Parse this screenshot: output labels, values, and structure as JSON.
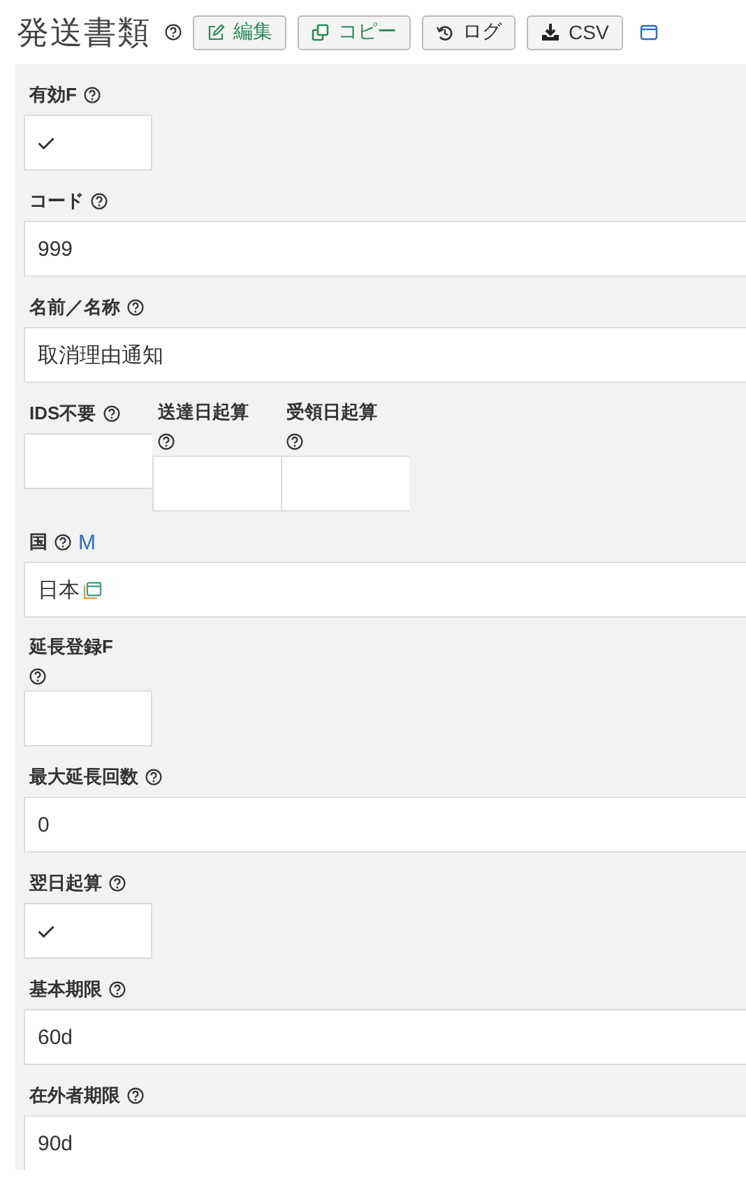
{
  "header": {
    "title": "発送書類",
    "buttons": [
      {
        "kind": "edit",
        "label": "編集"
      },
      {
        "kind": "copy",
        "label": "コピー"
      },
      {
        "kind": "log",
        "label": "ログ"
      },
      {
        "kind": "download",
        "label": "CSV"
      }
    ]
  },
  "fields": [
    {
      "kind": "check",
      "label": "有効F",
      "checked": true
    },
    {
      "kind": "text",
      "label": "コード",
      "value": "999"
    },
    {
      "kind": "text",
      "label": "名前／名称",
      "value": "取消理由通知"
    },
    {
      "kind": "group",
      "fields": [
        {
          "kind": "check",
          "label": "IDS不要",
          "checked": false
        },
        {
          "kind": "check",
          "label": "送達日起算",
          "checked": false
        },
        {
          "kind": "check",
          "label": "受領日起算",
          "checked": false
        }
      ]
    },
    {
      "kind": "link",
      "label": "国",
      "badge": "M",
      "value": "日本"
    },
    {
      "kind": "check",
      "label": "延長登録F",
      "checked": false
    },
    {
      "kind": "text",
      "label": "最大延長回数",
      "value": "0"
    },
    {
      "kind": "check",
      "label": "翌日起算",
      "checked": true
    },
    {
      "kind": "text",
      "label": "基本期限",
      "value": "60d"
    },
    {
      "kind": "text",
      "label": "在外者期限",
      "value": "90d"
    }
  ]
}
